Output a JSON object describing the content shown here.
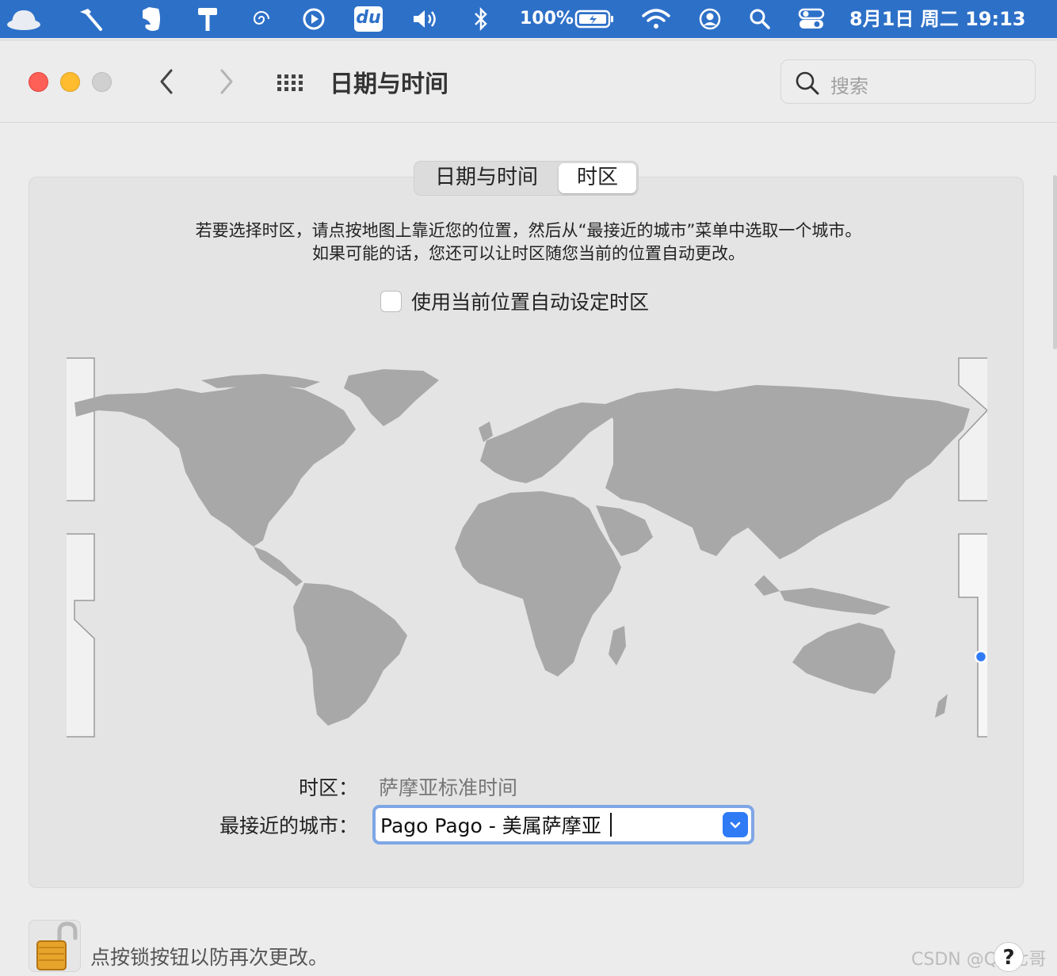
{
  "menubar": {
    "icons": [
      "cloud-app-icon",
      "hammer-icon",
      "evernote-icon",
      "paint-roller-icon",
      "spiral-icon",
      "play-circle-icon",
      "du-app-icon",
      "volume-icon",
      "bluetooth-icon",
      "battery-icon",
      "wifi-icon",
      "user-account-icon",
      "spotlight-icon",
      "control-center-icon"
    ],
    "du_label": "du",
    "battery_percent": "100%",
    "datetime": "8月1日 周二  19:13"
  },
  "window": {
    "title": "日期与时间",
    "search_placeholder": "搜索"
  },
  "tabs": [
    {
      "label": "日期与时间",
      "selected": false
    },
    {
      "label": "时区",
      "selected": true
    }
  ],
  "panel": {
    "instruction_line1": "若要选择时区，请点按地图上靠近您的位置，然后从“最接近的城市”菜单中选取一个城市。",
    "instruction_line2": "如果可能的话，您还可以让时区随您当前的位置自动更改。",
    "auto_timezone_label": "使用当前位置自动设定时区",
    "auto_timezone_checked": false,
    "timezone_label": "时区：",
    "timezone_value": "萨摩亚标准时间",
    "closest_city_label": "最接近的城市：",
    "closest_city_value": "Pago Pago - 美属萨摩亚"
  },
  "footer": {
    "lock_text": "点按锁按钮以防再次更改。",
    "help_label": "?",
    "watermark": "CSDN @QQ七哥"
  },
  "colors": {
    "menubar": "#2d70c8",
    "accent": "#2f7bf5",
    "map_land": "#a8a8a8",
    "map_selected_dot": "#2f7bf5"
  }
}
